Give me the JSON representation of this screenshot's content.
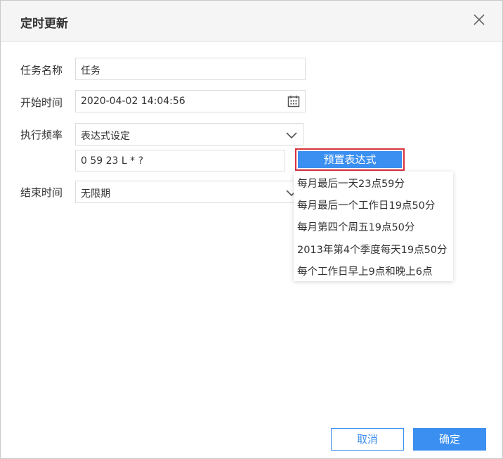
{
  "dialog": {
    "title": "定时更新",
    "close_icon": "close-icon"
  },
  "form": {
    "task_name": {
      "label": "任务名称",
      "value": "任务"
    },
    "start_time": {
      "label": "开始时间",
      "value": "2020-04-02 14:04:56",
      "icon": "calendar-icon"
    },
    "frequency": {
      "label": "执行频率",
      "value": "表达式设定"
    },
    "expression": {
      "value": "0 59 23 L * ?"
    },
    "preset_button": "预置表达式",
    "end_time": {
      "label": "结束时间",
      "value": "无限期"
    }
  },
  "preset_dropdown": {
    "items": [
      "每月最后一天23点59分",
      "每月最后一个工作日19点50分",
      "每月第四个周五19点50分",
      "2013年第4个季度每天19点50分",
      "每个工作日早上9点和晚上6点"
    ]
  },
  "footer": {
    "cancel_label": "取消",
    "ok_label": "确定"
  },
  "colors": {
    "primary": "#3a8ff0",
    "highlight_border": "#d9333f"
  }
}
